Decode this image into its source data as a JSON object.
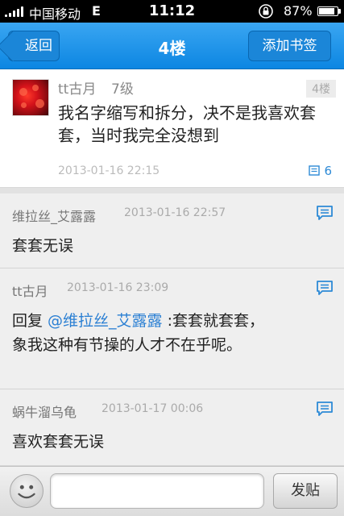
{
  "status_bar": {
    "carrier": "中国移动",
    "network": "E",
    "time": "11:12",
    "battery": "87%",
    "battery_level": 0.87
  },
  "nav": {
    "back_label": "返回",
    "title": "4楼",
    "bookmark_label": "添加书签"
  },
  "post": {
    "username": "tt古月",
    "level": "7级",
    "floor": "4楼",
    "content": "我名字缩写和拆分，决不是我喜欢套套，当时我完全没想到",
    "timestamp": "2013-01-16 22:15",
    "reply_count": "6"
  },
  "comments": [
    {
      "username": "维拉丝_艾露露",
      "timestamp": "2013-01-16 22:57",
      "prefix": "",
      "mention": "",
      "content": "套套无误"
    },
    {
      "username": "tt古月",
      "timestamp": "2013-01-16 23:09",
      "prefix": "回复 ",
      "mention": "@维拉丝_艾露露",
      "content": " :套套就套套，象我这种有节操的人才不在乎呢。"
    },
    {
      "username": "蜗牛溜乌龟",
      "timestamp": "2013-01-17 00:06",
      "prefix": "",
      "mention": "",
      "content": "喜欢套套无误"
    }
  ],
  "input_bar": {
    "placeholder": "",
    "send_label": "发贴"
  },
  "colors": {
    "nav_blue": "#1a8de6",
    "link_blue": "#2a7fd3"
  }
}
